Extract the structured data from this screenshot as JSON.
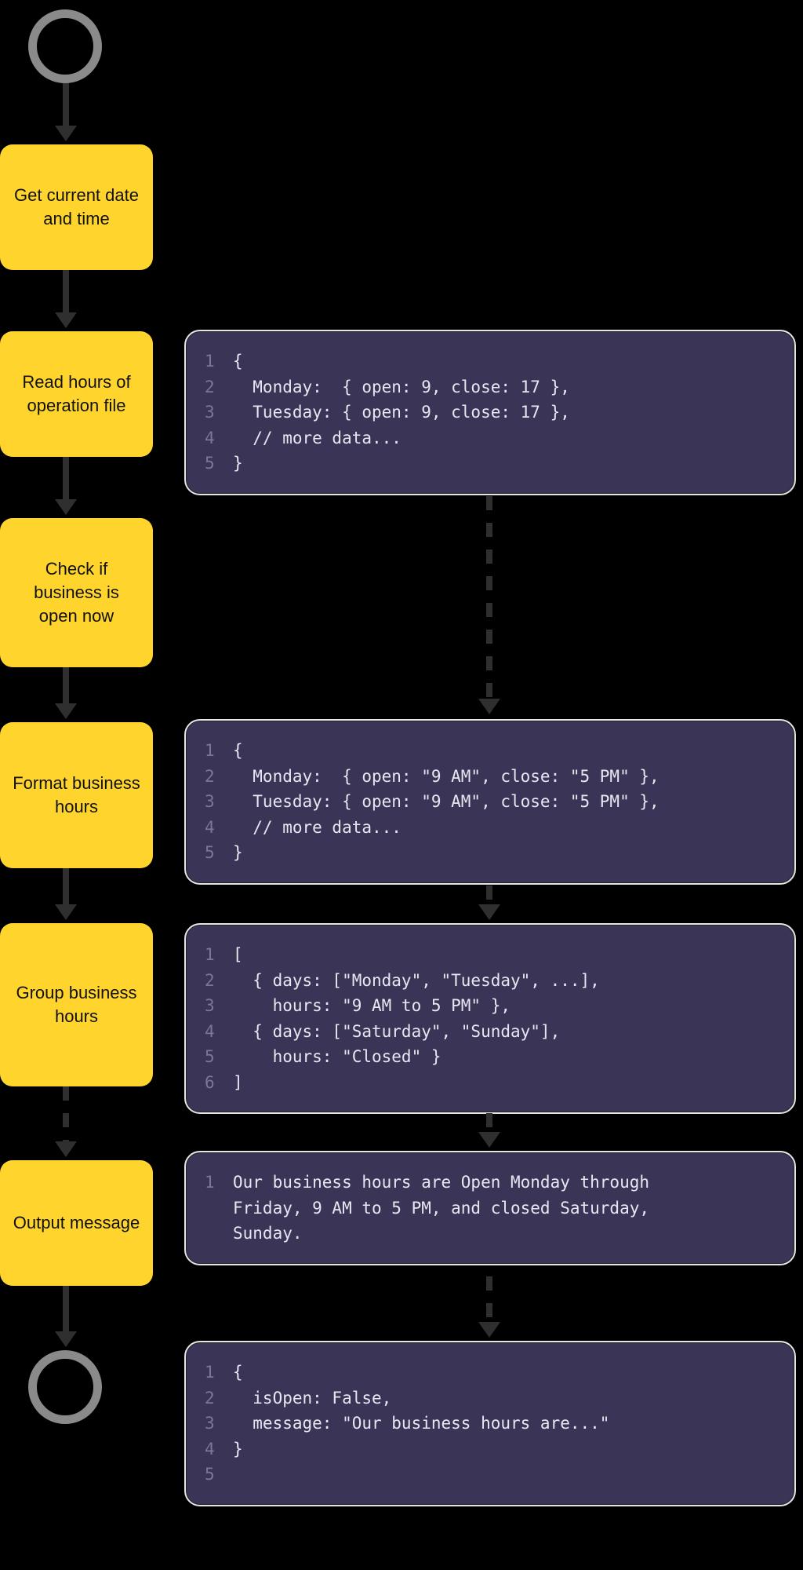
{
  "flow": {
    "steps": [
      {
        "id": "step1",
        "label": "Get current date and time"
      },
      {
        "id": "step2",
        "label": "Read hours of operation file"
      },
      {
        "id": "step3",
        "label": "Check if business is open now"
      },
      {
        "id": "step4",
        "label": "Format business hours"
      },
      {
        "id": "step5",
        "label": "Group business hours"
      },
      {
        "id": "step6",
        "label": "Output message"
      }
    ]
  },
  "code_panels": {
    "panel1": {
      "lines": [
        "{",
        "  Monday:  { open: 9, close: 17 },",
        "  Tuesday: { open: 9, close: 17 },",
        "  // more data...",
        "}"
      ]
    },
    "panel2": {
      "lines": [
        "{",
        "  Monday:  { open: \"9 AM\", close: \"5 PM\" },",
        "  Tuesday: { open: \"9 AM\", close: \"5 PM\" },",
        "  // more data...",
        "}"
      ]
    },
    "panel3": {
      "lines": [
        "[",
        "  { days: [\"Monday\", \"Tuesday\", ...],",
        "    hours: \"9 AM to 5 PM\" },",
        "  { days: [\"Saturday\", \"Sunday\"],",
        "    hours: \"Closed\" }",
        "]"
      ]
    },
    "panel4": {
      "lines": [
        "Our business hours are Open Monday through",
        "Friday, 9 AM to 5 PM, and closed Saturday,",
        "Sunday."
      ]
    },
    "panel5": {
      "lines": [
        "{",
        "  isOpen: False,",
        "  message: \"Our business hours are...\"",
        "}",
        ""
      ]
    }
  },
  "colors": {
    "process_bg": "#ffd52d",
    "code_bg": "#3a3457",
    "circle_border": "#8a8a8a",
    "arrow": "#2f2f2f"
  }
}
